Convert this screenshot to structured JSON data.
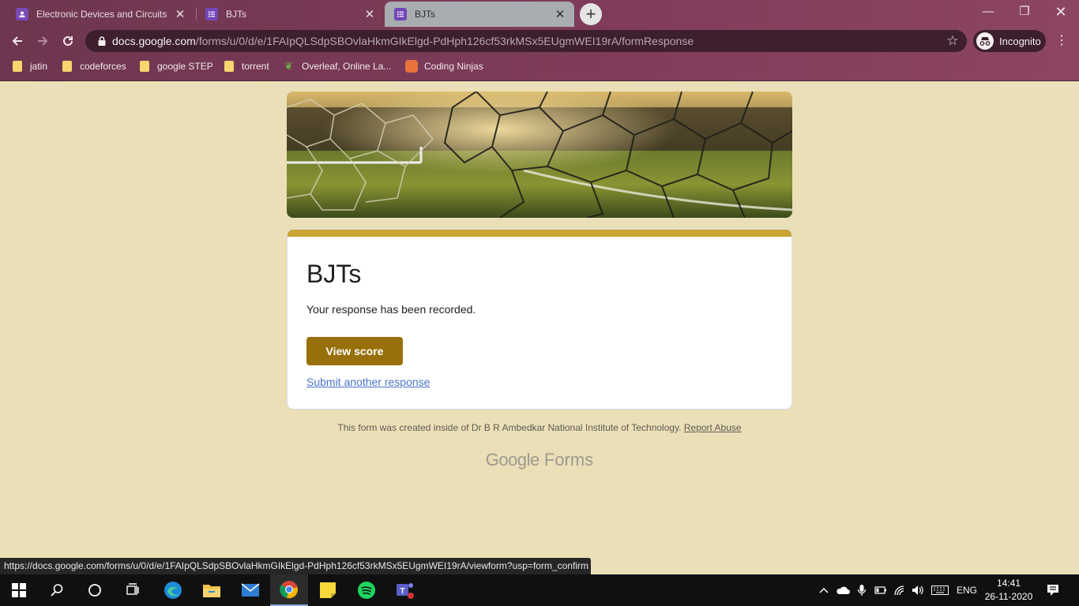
{
  "browser": {
    "tabs": [
      {
        "title": "Electronic Devices and Circuits (E",
        "favicon": "classroom-icon",
        "active": false
      },
      {
        "title": "BJTs",
        "favicon": "forms-icon",
        "active": false
      },
      {
        "title": "BJTs",
        "favicon": "forms-icon",
        "active": true
      }
    ],
    "address": {
      "host": "docs.google.com",
      "path": "/forms/u/0/d/e/1FAIpQLSdpSBOvlaHkmGIkElgd-PdHph126cf53rkMSx5EUgmWEI19rA/formResponse"
    },
    "profile_label": "Incognito",
    "bookmarks": [
      {
        "label": "jatin",
        "icon": "folder-icon"
      },
      {
        "label": "codeforces",
        "icon": "folder-icon"
      },
      {
        "label": "google STEP",
        "icon": "folder-icon"
      },
      {
        "label": "torrent",
        "icon": "folder-icon"
      },
      {
        "label": "Overleaf, Online La...",
        "icon": "overleaf-icon"
      },
      {
        "label": "Coding Ninjas",
        "icon": "coding-ninjas-icon"
      }
    ],
    "status_url": "https://docs.google.com/forms/u/0/d/e/1FAIpQLSdpSBOvlaHkmGIkElgd-PdHph126cf53rkMSx5EUgmWEI19rA/viewform?usp=form_confirm"
  },
  "form": {
    "title": "BJTs",
    "confirmation": "Your response has been recorded.",
    "view_score_label": "View score",
    "submit_another_label": "Submit another response",
    "accent_color": "#c9a531",
    "button_color": "#98700b"
  },
  "footer": {
    "note": "This form was created inside of Dr B R Ambedkar National Institute of Technology.",
    "report_abuse": "Report Abuse",
    "brand_google": "Google",
    "brand_forms": "Forms"
  },
  "taskbar": {
    "language": "ENG",
    "time": "14:41",
    "date": "26-11-2020"
  }
}
